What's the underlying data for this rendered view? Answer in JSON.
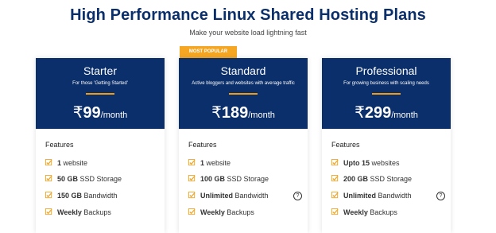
{
  "header": {
    "title": "High Performance Linux Shared Hosting Plans",
    "subtitle": "Make your website load lightning fast"
  },
  "badge": "MOST POPULAR",
  "features_label": "Features",
  "help_symbol": "?",
  "colors": {
    "primary": "#0b2f6b",
    "accent": "#f5a623"
  },
  "plans": [
    {
      "name": "Starter",
      "desc": "For those 'Getting Started'",
      "currency": "₹",
      "price": "99",
      "period": "/month",
      "features": [
        {
          "bold": "1",
          "text": " website"
        },
        {
          "bold": "50 GB",
          "text": " SSD Storage"
        },
        {
          "bold": "150 GB",
          "text": " Bandwidth"
        },
        {
          "bold": "Weekly",
          "text": " Backups"
        }
      ]
    },
    {
      "name": "Standard",
      "desc": "Active bloggers and websites with average traffic",
      "currency": "₹",
      "price": "189",
      "period": "/month",
      "features": [
        {
          "bold": "1",
          "text": " website"
        },
        {
          "bold": "100 GB",
          "text": " SSD Storage"
        },
        {
          "bold": "Unlimited",
          "text": " Bandwidth"
        },
        {
          "bold": "Weekly",
          "text": " Backups"
        }
      ]
    },
    {
      "name": "Professional",
      "desc": "For growing business with scaling needs",
      "currency": "₹",
      "price": "299",
      "period": "/month",
      "features": [
        {
          "bold": "Upto 15",
          "text": " websites"
        },
        {
          "bold": "200 GB",
          "text": " SSD Storage"
        },
        {
          "bold": "Unlimited",
          "text": " Bandwidth"
        },
        {
          "bold": "Weekly",
          "text": " Backups"
        }
      ]
    }
  ]
}
